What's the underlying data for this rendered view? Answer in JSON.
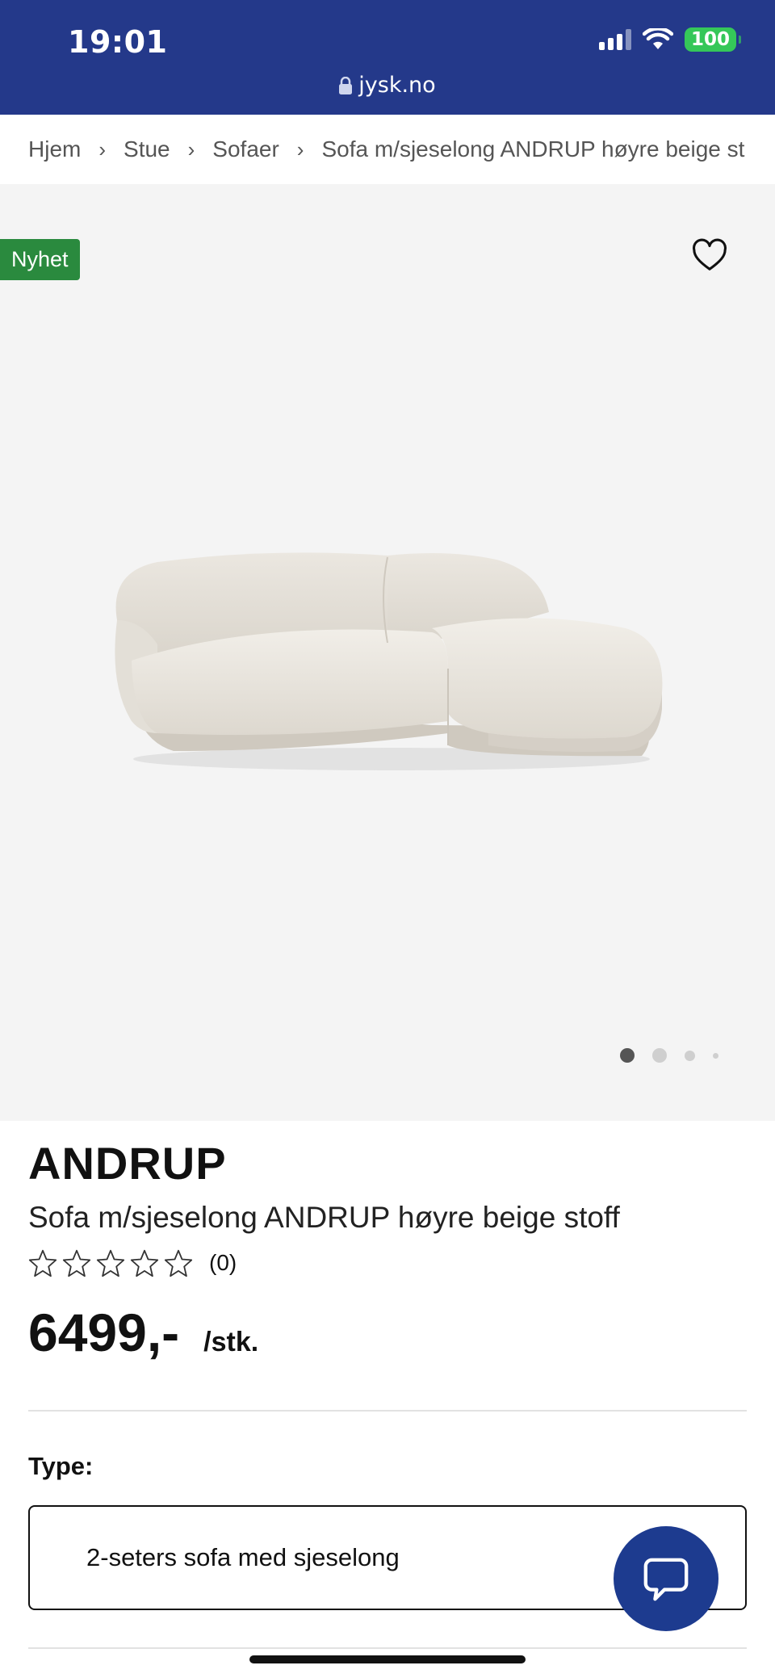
{
  "status_bar": {
    "time": "19:01",
    "battery": "100",
    "url": "jysk.no"
  },
  "breadcrumb": {
    "items": [
      "Hjem",
      "Stue",
      "Sofaer",
      "Sofa m/sjeselong ANDRUP høyre beige st"
    ]
  },
  "gallery": {
    "badge": "Nyhet",
    "image_count": 4,
    "active_index": 0
  },
  "product": {
    "brand": "ANDRUP",
    "title": "Sofa m/sjeselong ANDRUP høyre beige stoff",
    "rating_count": "(0)",
    "rating_value": 0,
    "rating_max": 5,
    "price": "6499,-",
    "unit": "/stk."
  },
  "type_selector": {
    "label": "Type:",
    "value": "2-seters sofa med sjeselong"
  },
  "colors": {
    "brand_blue": "#24398a",
    "badge_green": "#2a8a3e",
    "chat_blue": "#1d3b8f"
  }
}
